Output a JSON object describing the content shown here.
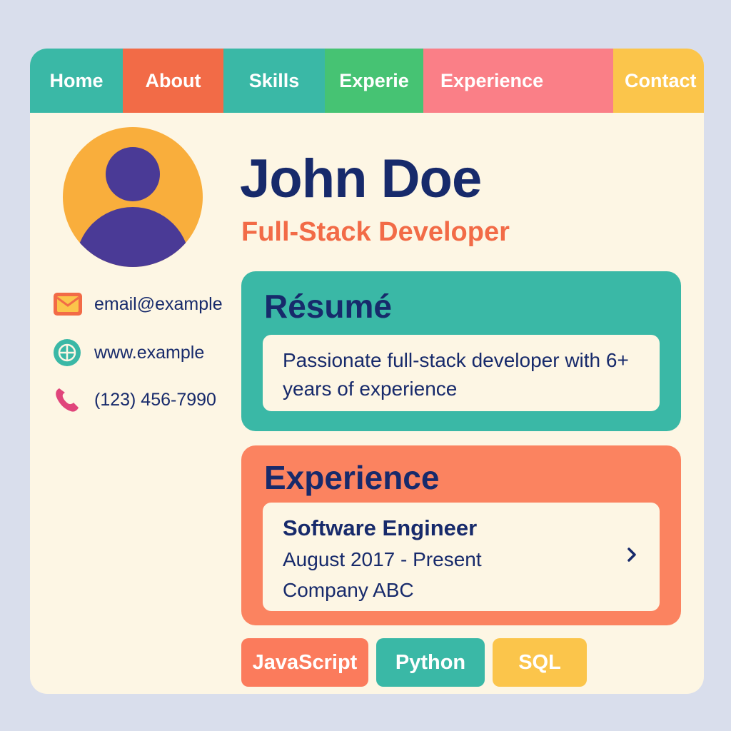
{
  "nav": {
    "tabs": [
      {
        "label": "Home",
        "color": "#3ab8a6"
      },
      {
        "label": "About",
        "color": "#f26b47"
      },
      {
        "label": "Skills",
        "color": "#3ab8a6"
      },
      {
        "label": "Experie",
        "color": "#46c373"
      },
      {
        "label": "Experience",
        "color": "#fa7f87"
      },
      {
        "label": "Contact",
        "color": "#fbc54b"
      }
    ]
  },
  "profile": {
    "avatar_icon": "user-avatar-icon",
    "name": "John Doe",
    "title": "Full-Stack Developer"
  },
  "contact": {
    "email": {
      "icon": "envelope-icon",
      "text": "email@example"
    },
    "website": {
      "icon": "globe-icon",
      "text": "www.example"
    },
    "phone": {
      "icon": "phone-icon",
      "text": "(123) 456-7990"
    }
  },
  "resume": {
    "heading": "Résumé",
    "summary": "Passionate full-stack developer with 6+ years of experience"
  },
  "experience": {
    "heading": "Experience",
    "job": {
      "title": "Software Engineer",
      "dates": "August 2017 - Present",
      "company": "Company ABC",
      "chevron_icon": "chevron-right-icon"
    }
  },
  "skills": [
    {
      "label": "JavaScript",
      "color": "#fb7b5c"
    },
    {
      "label": "Python",
      "color": "#3ab8a6"
    },
    {
      "label": "SQL",
      "color": "#fbc54b"
    }
  ],
  "colors": {
    "page_bg": "#d9deec",
    "card_bg": "#fdf6e4",
    "text_dark": "#172a6b",
    "accent_orange": "#f26b47",
    "teal": "#3ab8a6",
    "coral": "#fb8360",
    "avatar_bg": "#f9ae3c",
    "avatar_fg": "#4a3a96"
  }
}
